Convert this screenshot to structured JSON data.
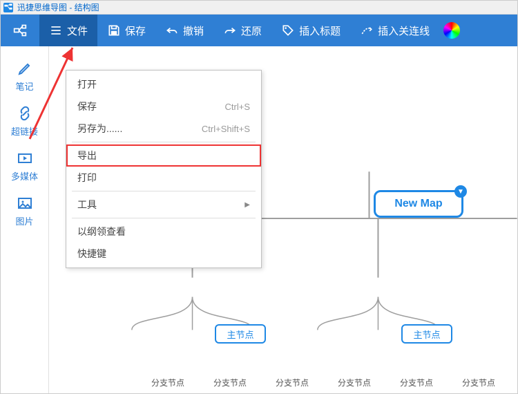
{
  "titlebar": {
    "text": "迅捷思维导图 - 结构图"
  },
  "toolbar": {
    "file": "文件",
    "save": "保存",
    "undo": "撤销",
    "redo": "还原",
    "insert_title": "插入标题",
    "insert_connector": "插入关连线"
  },
  "sidebar": {
    "note": "笔记",
    "hyperlink": "超链接",
    "multimedia": "多媒体",
    "image": "图片"
  },
  "menu": {
    "open": "打开",
    "save": "保存",
    "save_shortcut": "Ctrl+S",
    "save_as": "另存为......",
    "save_as_shortcut": "Ctrl+Shift+S",
    "export": "导出",
    "print": "打印",
    "tools": "工具",
    "outline": "以纲领查看",
    "shortcuts": "快捷键"
  },
  "map": {
    "root": "New Map",
    "main": "主节点",
    "leaf": "分支节点"
  }
}
